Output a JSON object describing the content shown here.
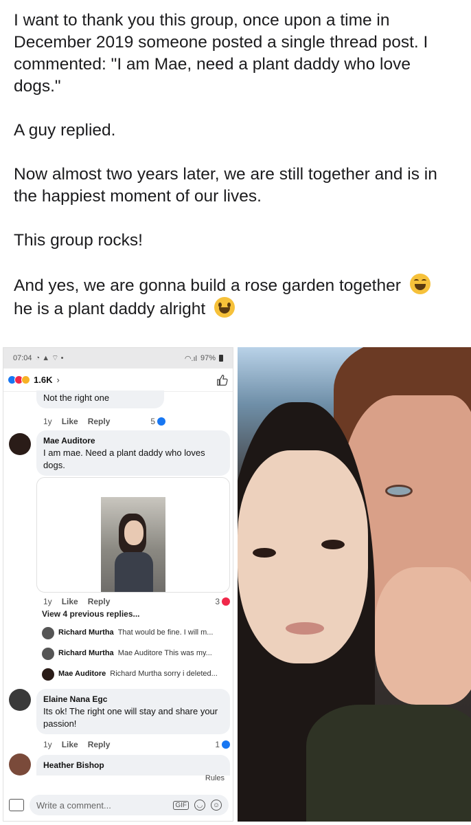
{
  "post": {
    "paragraph_1": "I want to thank you this group, once upon a time in December 2019 someone posted a single thread post. I commented: \"I am Mae, need a plant daddy who love dogs.\"",
    "paragraph_2": "A guy replied.",
    "paragraph_3": "Now almost two years later, we are still together and is in the happiest moment of our lives.",
    "paragraph_4": "This group rocks!",
    "paragraph_5a": "And yes, we are gonna build a rose garden together",
    "emoji_1": "laughing-squint-emoji",
    "paragraph_5b": "he is a plant daddy alright",
    "emoji_2": "grinning-emoji"
  },
  "screenshot": {
    "status": {
      "time": "07:04",
      "signal": "97%"
    },
    "reactions": {
      "count": "1.6K"
    },
    "comments": [
      {
        "text": "Not the right one",
        "time": "1y",
        "like": "Like",
        "reply": "Reply",
        "count": "5"
      },
      {
        "author": "Mae Auditore",
        "text": "I am mae. Need a plant daddy who loves dogs.",
        "time": "1y",
        "like": "Like",
        "reply": "Reply",
        "count": "3"
      },
      {
        "author": "Elaine Nana Egc",
        "text": "Its ok! The right one will stay and share your passion!",
        "time": "1y",
        "like": "Like",
        "reply": "Reply",
        "count": "1"
      },
      {
        "author": "Heather Bishop"
      }
    ],
    "view_previous": "View 4 previous replies...",
    "replies": [
      {
        "author": "Richard Murtha",
        "text": "That would be fine.  I will m..."
      },
      {
        "author": "Richard Murtha",
        "text": "Mae Auditore This was my..."
      },
      {
        "author": "Mae Auditore",
        "text": "Richard Murtha sorry i deleted..."
      }
    ],
    "rules": "Rules",
    "compose_placeholder": "Write a comment...",
    "gif_label": "GIF"
  },
  "colors": {
    "like_blue": "#1877f2",
    "love_red": "#f0284a",
    "haha_yellow": "#f7b125"
  }
}
